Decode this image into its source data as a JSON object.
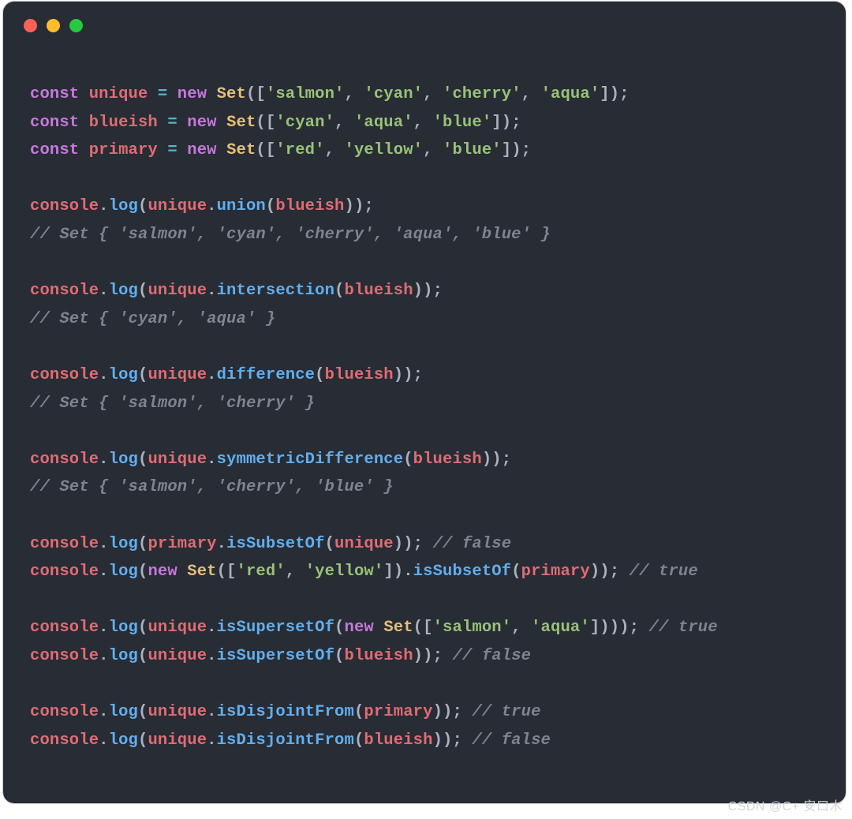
{
  "code_tokens": [
    [
      [
        "kw",
        "const"
      ],
      [
        "pun",
        " "
      ],
      [
        "obj",
        "unique"
      ],
      [
        "pun",
        " "
      ],
      [
        "eq",
        "="
      ],
      [
        "pun",
        " "
      ],
      [
        "kw",
        "new"
      ],
      [
        "pun",
        " "
      ],
      [
        "cls",
        "Set"
      ],
      [
        "pun",
        "(["
      ],
      [
        "str",
        "'salmon'"
      ],
      [
        "pun",
        ", "
      ],
      [
        "str",
        "'cyan'"
      ],
      [
        "pun",
        ", "
      ],
      [
        "str",
        "'cherry'"
      ],
      [
        "pun",
        ", "
      ],
      [
        "str",
        "'aqua'"
      ],
      [
        "pun",
        "]);"
      ]
    ],
    [
      [
        "kw",
        "const"
      ],
      [
        "pun",
        " "
      ],
      [
        "obj",
        "blueish"
      ],
      [
        "pun",
        " "
      ],
      [
        "eq",
        "="
      ],
      [
        "pun",
        " "
      ],
      [
        "kw",
        "new"
      ],
      [
        "pun",
        " "
      ],
      [
        "cls",
        "Set"
      ],
      [
        "pun",
        "(["
      ],
      [
        "str",
        "'cyan'"
      ],
      [
        "pun",
        ", "
      ],
      [
        "str",
        "'aqua'"
      ],
      [
        "pun",
        ", "
      ],
      [
        "str",
        "'blue'"
      ],
      [
        "pun",
        "]);"
      ]
    ],
    [
      [
        "kw",
        "const"
      ],
      [
        "pun",
        " "
      ],
      [
        "obj",
        "primary"
      ],
      [
        "pun",
        " "
      ],
      [
        "eq",
        "="
      ],
      [
        "pun",
        " "
      ],
      [
        "kw",
        "new"
      ],
      [
        "pun",
        " "
      ],
      [
        "cls",
        "Set"
      ],
      [
        "pun",
        "(["
      ],
      [
        "str",
        "'red'"
      ],
      [
        "pun",
        ", "
      ],
      [
        "str",
        "'yellow'"
      ],
      [
        "pun",
        ", "
      ],
      [
        "str",
        "'blue'"
      ],
      [
        "pun",
        "]);"
      ]
    ],
    [],
    [
      [
        "obj",
        "console"
      ],
      [
        "pun",
        "."
      ],
      [
        "fn",
        "log"
      ],
      [
        "pun",
        "("
      ],
      [
        "obj",
        "unique"
      ],
      [
        "pun",
        "."
      ],
      [
        "fn",
        "union"
      ],
      [
        "pun",
        "("
      ],
      [
        "obj",
        "blueish"
      ],
      [
        "pun",
        "));"
      ]
    ],
    [
      [
        "cmt",
        "// Set { 'salmon', 'cyan', 'cherry', 'aqua', 'blue' }"
      ]
    ],
    [],
    [
      [
        "obj",
        "console"
      ],
      [
        "pun",
        "."
      ],
      [
        "fn",
        "log"
      ],
      [
        "pun",
        "("
      ],
      [
        "obj",
        "unique"
      ],
      [
        "pun",
        "."
      ],
      [
        "fn",
        "intersection"
      ],
      [
        "pun",
        "("
      ],
      [
        "obj",
        "blueish"
      ],
      [
        "pun",
        "));"
      ]
    ],
    [
      [
        "cmt",
        "// Set { 'cyan', 'aqua' }"
      ]
    ],
    [],
    [
      [
        "obj",
        "console"
      ],
      [
        "pun",
        "."
      ],
      [
        "fn",
        "log"
      ],
      [
        "pun",
        "("
      ],
      [
        "obj",
        "unique"
      ],
      [
        "pun",
        "."
      ],
      [
        "fn",
        "difference"
      ],
      [
        "pun",
        "("
      ],
      [
        "obj",
        "blueish"
      ],
      [
        "pun",
        "));"
      ]
    ],
    [
      [
        "cmt",
        "// Set { 'salmon', 'cherry' }"
      ]
    ],
    [],
    [
      [
        "obj",
        "console"
      ],
      [
        "pun",
        "."
      ],
      [
        "fn",
        "log"
      ],
      [
        "pun",
        "("
      ],
      [
        "obj",
        "unique"
      ],
      [
        "pun",
        "."
      ],
      [
        "fn",
        "symmetricDifference"
      ],
      [
        "pun",
        "("
      ],
      [
        "obj",
        "blueish"
      ],
      [
        "pun",
        "));"
      ]
    ],
    [
      [
        "cmt",
        "// Set { 'salmon', 'cherry', 'blue' }"
      ]
    ],
    [],
    [
      [
        "obj",
        "console"
      ],
      [
        "pun",
        "."
      ],
      [
        "fn",
        "log"
      ],
      [
        "pun",
        "("
      ],
      [
        "obj",
        "primary"
      ],
      [
        "pun",
        "."
      ],
      [
        "fn",
        "isSubsetOf"
      ],
      [
        "pun",
        "("
      ],
      [
        "obj",
        "unique"
      ],
      [
        "pun",
        ")); "
      ],
      [
        "cmt",
        "// false"
      ]
    ],
    [
      [
        "obj",
        "console"
      ],
      [
        "pun",
        "."
      ],
      [
        "fn",
        "log"
      ],
      [
        "pun",
        "("
      ],
      [
        "kw",
        "new"
      ],
      [
        "pun",
        " "
      ],
      [
        "cls",
        "Set"
      ],
      [
        "pun",
        "(["
      ],
      [
        "str",
        "'red'"
      ],
      [
        "pun",
        ", "
      ],
      [
        "str",
        "'yellow'"
      ],
      [
        "pun",
        "])."
      ],
      [
        "fn",
        "isSubsetOf"
      ],
      [
        "pun",
        "("
      ],
      [
        "obj",
        "primary"
      ],
      [
        "pun",
        ")); "
      ],
      [
        "cmt",
        "// true"
      ]
    ],
    [],
    [
      [
        "obj",
        "console"
      ],
      [
        "pun",
        "."
      ],
      [
        "fn",
        "log"
      ],
      [
        "pun",
        "("
      ],
      [
        "obj",
        "unique"
      ],
      [
        "pun",
        "."
      ],
      [
        "fn",
        "isSupersetOf"
      ],
      [
        "pun",
        "("
      ],
      [
        "kw",
        "new"
      ],
      [
        "pun",
        " "
      ],
      [
        "cls",
        "Set"
      ],
      [
        "pun",
        "(["
      ],
      [
        "str",
        "'salmon'"
      ],
      [
        "pun",
        ", "
      ],
      [
        "str",
        "'aqua'"
      ],
      [
        "pun",
        "]))); "
      ],
      [
        "cmt",
        "// true"
      ]
    ],
    [
      [
        "obj",
        "console"
      ],
      [
        "pun",
        "."
      ],
      [
        "fn",
        "log"
      ],
      [
        "pun",
        "("
      ],
      [
        "obj",
        "unique"
      ],
      [
        "pun",
        "."
      ],
      [
        "fn",
        "isSupersetOf"
      ],
      [
        "pun",
        "("
      ],
      [
        "obj",
        "blueish"
      ],
      [
        "pun",
        ")); "
      ],
      [
        "cmt",
        "// false"
      ]
    ],
    [],
    [
      [
        "obj",
        "console"
      ],
      [
        "pun",
        "."
      ],
      [
        "fn",
        "log"
      ],
      [
        "pun",
        "("
      ],
      [
        "obj",
        "unique"
      ],
      [
        "pun",
        "."
      ],
      [
        "fn",
        "isDisjointFrom"
      ],
      [
        "pun",
        "("
      ],
      [
        "obj",
        "primary"
      ],
      [
        "pun",
        ")); "
      ],
      [
        "cmt",
        "// true"
      ]
    ],
    [
      [
        "obj",
        "console"
      ],
      [
        "pun",
        "."
      ],
      [
        "fn",
        "log"
      ],
      [
        "pun",
        "("
      ],
      [
        "obj",
        "unique"
      ],
      [
        "pun",
        "."
      ],
      [
        "fn",
        "isDisjointFrom"
      ],
      [
        "pun",
        "("
      ],
      [
        "obj",
        "blueish"
      ],
      [
        "pun",
        ")); "
      ],
      [
        "cmt",
        "// false"
      ]
    ]
  ],
  "watermark": "CSDN @C+   安口木"
}
